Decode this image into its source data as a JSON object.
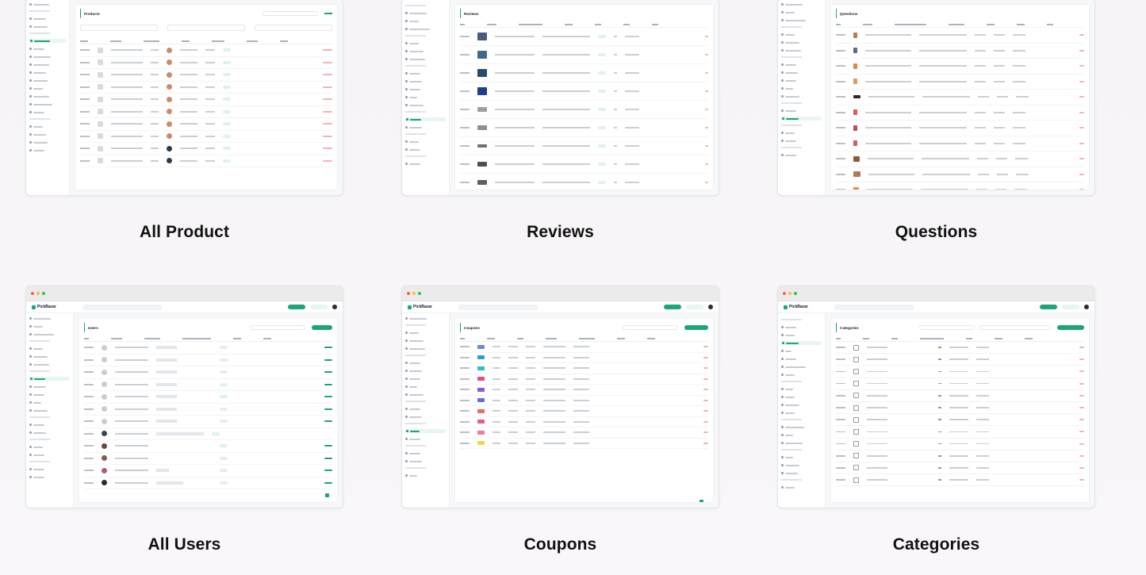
{
  "captions": {
    "all_product": "All Product",
    "reviews": "Reviews",
    "questions": "Questions",
    "all_users": "All Users",
    "coupons": "Coupons",
    "categories": "Categories"
  },
  "colors": {
    "accent": "#1aa57a",
    "titlebar_red": "#fe5f57",
    "titlebar_yellow": "#febc2e",
    "titlebar_green": "#28c840"
  }
}
